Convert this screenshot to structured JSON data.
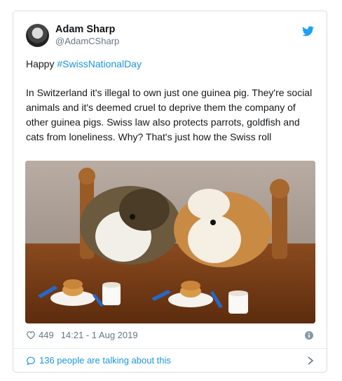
{
  "author": {
    "display_name": "Adam Sharp",
    "handle": "@AdamCSharp"
  },
  "tweet": {
    "greeting": "Happy ",
    "hashtag": "#SwissNationalDay",
    "body": "In Switzerland it's illegal to own just one guinea pig. They're social animals and it's deemed cruel to deprive them the company of other guinea pigs. Swiss law also protects parrots, goldfish and cats from loneliness. Why? That's just how the Swiss roll"
  },
  "stats": {
    "likes": "449",
    "timestamp": "14:21 - 1 Aug 2019"
  },
  "footer": {
    "talking": "136 people are talking about this"
  },
  "colors": {
    "accent": "#1b95e0",
    "muted": "#657786"
  },
  "icons": [
    "twitter-bird-icon",
    "heart-icon",
    "info-icon",
    "comment-icon",
    "chevron-right-icon"
  ]
}
